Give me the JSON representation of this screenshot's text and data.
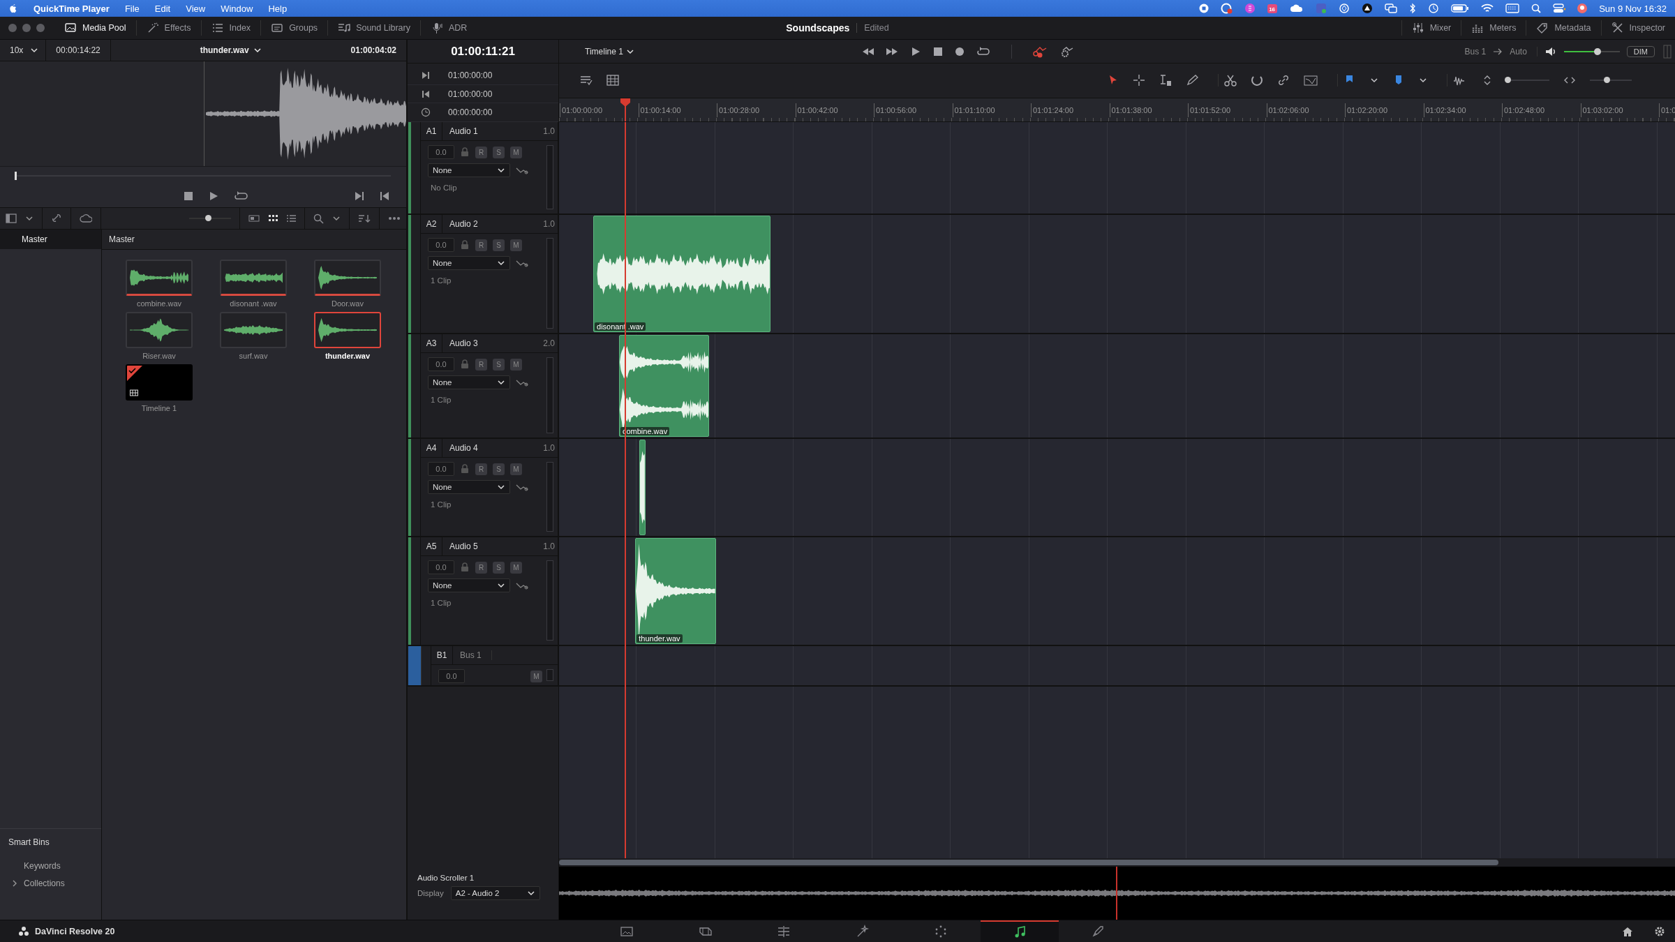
{
  "menubar": {
    "app": "QuickTime Player",
    "menus": [
      "File",
      "Edit",
      "View",
      "Window",
      "Help"
    ],
    "badge": "16",
    "clock": "Sun 9 Nov  16:32"
  },
  "titlebar": {
    "left_tabs": [
      {
        "label": "Media Pool",
        "kind": "pool",
        "selected": true
      },
      {
        "label": "Effects",
        "kind": "effects",
        "selected": false
      },
      {
        "label": "Index",
        "kind": "index",
        "selected": false
      },
      {
        "label": "Groups",
        "kind": "groups",
        "selected": false
      },
      {
        "label": "Sound Library",
        "kind": "library",
        "selected": false
      },
      {
        "label": "ADR",
        "kind": "adr",
        "selected": false
      }
    ],
    "project": "Soundscapes",
    "status": "Edited",
    "right_tabs": [
      {
        "label": "Mixer",
        "kind": "mixer",
        "selected": false
      },
      {
        "label": "Meters",
        "kind": "meters",
        "selected": false
      },
      {
        "label": "Metadata",
        "kind": "metadata",
        "selected": false
      },
      {
        "label": "Inspector",
        "kind": "inspector",
        "selected": false
      }
    ]
  },
  "viewer": {
    "zoom": "10x",
    "duration": "00:00:14:22",
    "clip": "thunder.wav",
    "timecode": "01:00:04:02",
    "scrub": {
      "level": 0
    }
  },
  "media_pool": {
    "thumbnail_size": {
      "level": 0.45
    },
    "bins": [
      {
        "label": "Master",
        "selected": true
      }
    ],
    "header": "Master",
    "clips": [
      {
        "name": "combine.wav",
        "kind": "audio",
        "in_use": true,
        "selected": false
      },
      {
        "name": "disonant .wav",
        "kind": "audio",
        "in_use": true,
        "selected": false
      },
      {
        "name": "Door.wav",
        "kind": "audio",
        "in_use": true,
        "selected": false
      },
      {
        "name": "Riser.wav",
        "kind": "audio",
        "in_use": false,
        "selected": false
      },
      {
        "name": "surf.wav",
        "kind": "audio",
        "in_use": false,
        "selected": false
      },
      {
        "name": "thunder.wav",
        "kind": "audio",
        "in_use": true,
        "selected": true
      },
      {
        "name": "Timeline 1",
        "kind": "timeline",
        "selected": false
      }
    ],
    "smart_bins": {
      "title": "Smart Bins",
      "items": [
        {
          "label": "Keywords",
          "expandable": false
        },
        {
          "label": "Collections",
          "expandable": true
        }
      ]
    }
  },
  "timeline": {
    "timecode": "01:00:11:21",
    "name": "Timeline 1",
    "marks": [
      {
        "kind": "in",
        "time": "01:00:00:00"
      },
      {
        "kind": "out",
        "time": "01:00:00:00"
      },
      {
        "kind": "duration",
        "time": "00:00:00:00"
      }
    ],
    "zoom_vertical": {
      "level": 0
    },
    "zoom_horizontal": {
      "level": 0.4
    },
    "ruler": [
      "01:00:00:00",
      "01:00:14:00",
      "01:00:28:00",
      "01:00:42:00",
      "01:00:56:00",
      "01:01:10:00",
      "01:01:24:00",
      "01:01:38:00",
      "01:01:52:00",
      "01:02:06:00",
      "01:02:20:00",
      "01:02:34:00",
      "01:02:48:00",
      "01:03:02:00",
      "01:0"
    ],
    "bus_out": "Bus 1",
    "automation": "Auto",
    "monitor": {
      "level": 0.6
    },
    "dim": "DIM",
    "tracks": [
      {
        "kind": "audio",
        "id": "A1",
        "name": "Audio 1",
        "gain": "1.0",
        "volume": "0.0",
        "buttons": [
          "R",
          "S",
          "M"
        ],
        "effect": "None",
        "status": "No Clip"
      },
      {
        "kind": "audio",
        "id": "A2",
        "name": "Audio 2",
        "gain": "1.0",
        "volume": "0.0",
        "buttons": [
          "R",
          "S",
          "M"
        ],
        "effect": "None",
        "status": "1 Clip",
        "clips": [
          {
            "name": "disonant .wav",
            "kind": "mono"
          }
        ]
      },
      {
        "kind": "audio",
        "id": "A3",
        "name": "Audio 3",
        "gain": "2.0",
        "volume": "0.0",
        "buttons": [
          "R",
          "S",
          "M"
        ],
        "effect": "None",
        "status": "1 Clip",
        "clips": [
          {
            "name": "combine.wav",
            "kind": "stereo"
          }
        ]
      },
      {
        "kind": "audio",
        "id": "A4",
        "name": "Audio 4",
        "gain": "1.0",
        "volume": "0.0",
        "buttons": [
          "R",
          "S",
          "M"
        ],
        "effect": "None",
        "status": "1 Clip",
        "clips": [
          {
            "kind": "mono"
          }
        ]
      },
      {
        "kind": "audio",
        "id": "A5",
        "name": "Audio 5",
        "gain": "1.0",
        "volume": "0.0",
        "buttons": [
          "R",
          "S",
          "M"
        ],
        "effect": "None",
        "status": "1 Clip",
        "clips": [
          {
            "name": "thunder.wav",
            "kind": "mono"
          }
        ]
      },
      {
        "kind": "bus",
        "id": "B1",
        "name": "Bus 1",
        "volume": "0.0",
        "buttons": [
          "M"
        ]
      }
    ],
    "scroller": {
      "title": "Audio Scroller 1",
      "display_label": "Display",
      "display": "A2 - Audio 2"
    }
  },
  "bottombar": {
    "app": "DaVinci Resolve 20",
    "pages": [
      {
        "kind": "media",
        "selected": false
      },
      {
        "kind": "cut",
        "selected": false
      },
      {
        "kind": "edit",
        "selected": false
      },
      {
        "kind": "fusion",
        "selected": false
      },
      {
        "kind": "color",
        "selected": false
      },
      {
        "kind": "fairlight",
        "selected": true
      },
      {
        "kind": "deliver",
        "selected": false
      }
    ]
  }
}
